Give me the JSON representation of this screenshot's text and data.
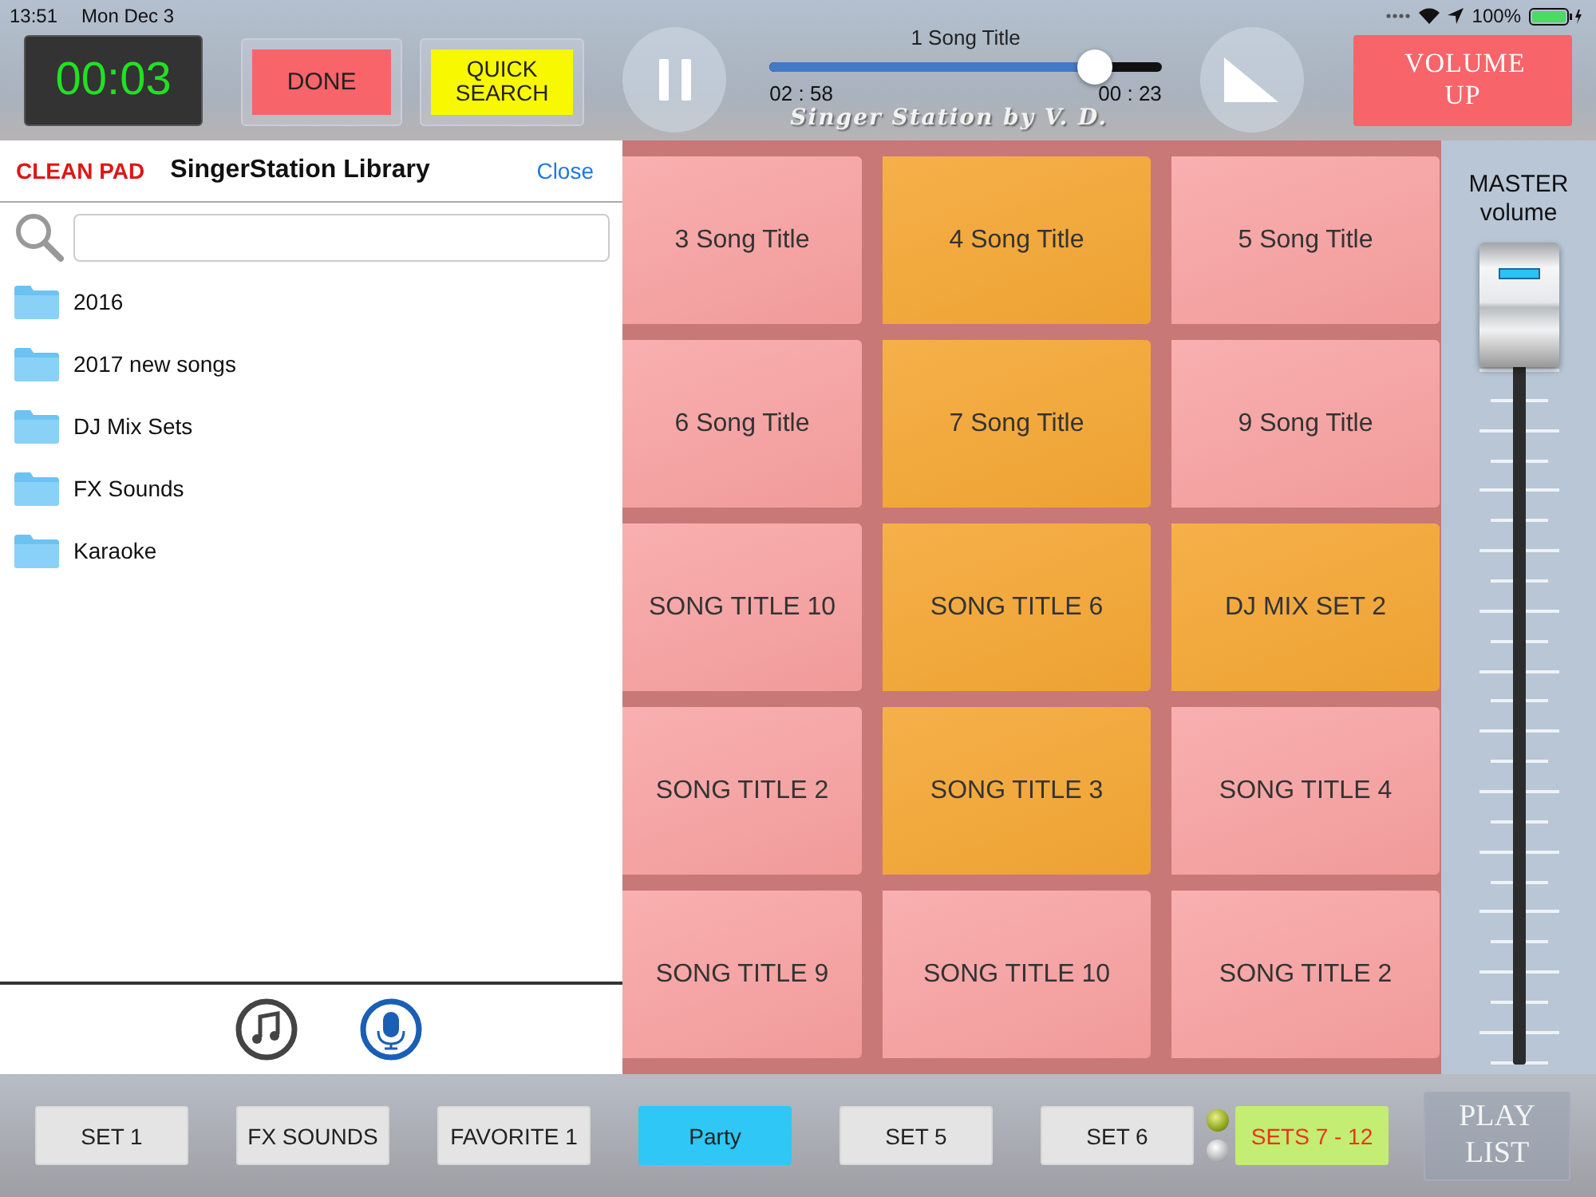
{
  "status_bar": {
    "time": "13:51",
    "date": "Mon Dec 3",
    "battery": "100%"
  },
  "top": {
    "timer": "00:03",
    "done": "DONE",
    "quick_search": "QUICK SEARCH",
    "now_playing": {
      "title": "1 Song Title",
      "elapsed": "02 : 58",
      "remaining": "00 : 23",
      "level": 0.83
    },
    "logo": "Singer Station by V. D.",
    "volume_up": "VOLUME UP"
  },
  "library": {
    "clean_pad": "CLEAN PAD",
    "title": "SingerStation Library",
    "close": "Close",
    "folders": [
      {
        "name": "2016"
      },
      {
        "name": "2017 new songs"
      },
      {
        "name": "DJ Mix Sets"
      },
      {
        "name": "FX Sounds"
      },
      {
        "name": "Karaoke"
      }
    ],
    "tabs": [
      {
        "kind": "music",
        "selected": false
      },
      {
        "kind": "mic",
        "selected": true
      }
    ]
  },
  "pads": [
    {
      "title": "3 Song Title",
      "highlighted": false
    },
    {
      "title": "4 Song Title",
      "highlighted": true
    },
    {
      "title": "5 Song Title",
      "highlighted": false
    },
    {
      "title": "6 Song Title",
      "highlighted": false
    },
    {
      "title": "7 Song Title",
      "highlighted": true
    },
    {
      "title": "9 Song Title",
      "highlighted": false
    },
    {
      "title": "SONG TITLE 10",
      "highlighted": false
    },
    {
      "title": "SONG TITLE 6",
      "highlighted": true
    },
    {
      "title": "DJ MIX SET 2",
      "highlighted": true
    },
    {
      "title": "SONG TITLE 2",
      "highlighted": false
    },
    {
      "title": "SONG TITLE 3",
      "highlighted": true
    },
    {
      "title": "SONG TITLE 4",
      "highlighted": false
    },
    {
      "title": "SONG TITLE 9",
      "highlighted": false
    },
    {
      "title": "SONG TITLE 10",
      "highlighted": false
    },
    {
      "title": "SONG TITLE 2",
      "highlighted": false
    }
  ],
  "master": {
    "label_1": "MASTER",
    "label_2": "volume",
    "level": 1
  },
  "sets": [
    {
      "label": "SET 1",
      "selected": false
    },
    {
      "label": "FX SOUNDS",
      "selected": false
    },
    {
      "label": "FAVORITE 1",
      "selected": false
    },
    {
      "label": "Party",
      "selected": true
    },
    {
      "label": "SET 5",
      "selected": false
    },
    {
      "label": "SET 6",
      "selected": false
    }
  ],
  "indicators": [
    {
      "on": true
    },
    {
      "on": false
    }
  ],
  "sets_range": "SETS 7 - 12",
  "play_list": "PLAY LIST"
}
